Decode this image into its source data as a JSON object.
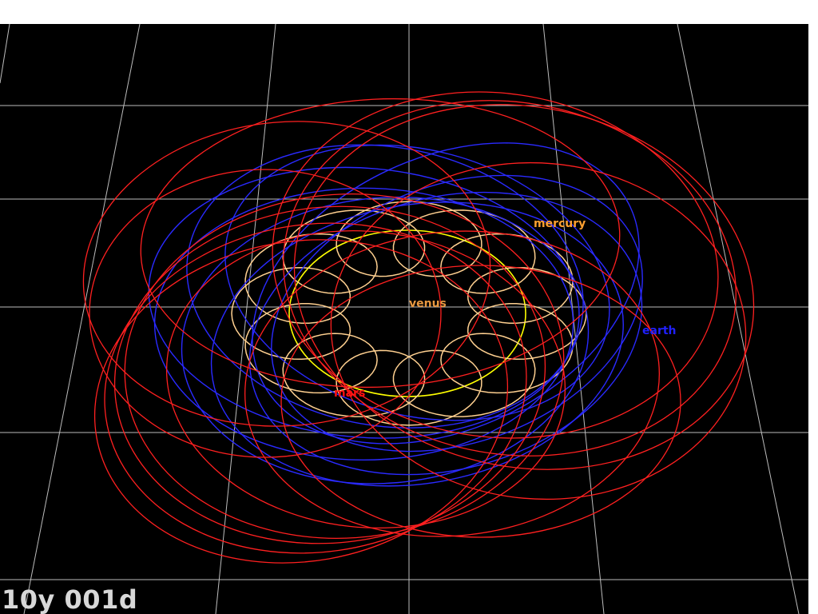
{
  "simulation": {
    "elapsed_label": "10y 001d"
  },
  "planets": [
    {
      "key": "venus",
      "label": "venus",
      "color": "#ffd090",
      "label_color": "#e89840"
    },
    {
      "key": "mercury",
      "label": "mercury",
      "color": "#ff2020",
      "label_color": "#ffa030"
    },
    {
      "key": "earth",
      "label": "earth",
      "color": "#2a2aff",
      "label_color": "#2020ff"
    },
    {
      "key": "mars",
      "label": "mars",
      "color": "#ff2020",
      "label_color": "#ff1010"
    }
  ],
  "sun_orbit": {
    "color": "#ffff00"
  },
  "grid": {
    "color": "#bdbdbd",
    "visible": true
  }
}
